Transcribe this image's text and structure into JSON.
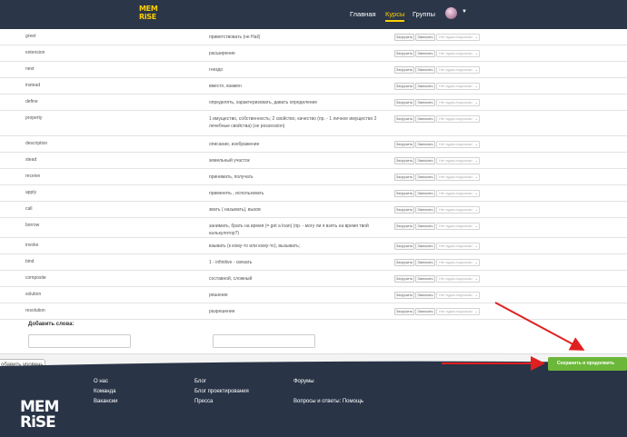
{
  "header": {
    "logo_line1": "MEM",
    "logo_line2": "RiSE",
    "nav": [
      "Главная",
      "Курсы",
      "Группы"
    ],
    "active_nav": "Курсы"
  },
  "rows": [
    {
      "word": "greet",
      "translation": "приветствовать (не Hail)",
      "upload": "Загрузить",
      "record": "Записать",
      "audio": "Нет аудио-подсказки"
    },
    {
      "word": "extension",
      "translation": "расширение",
      "upload": "Загрузить",
      "record": "Записать",
      "audio": "Нет аудио-подсказки"
    },
    {
      "word": "nest",
      "translation": "гнездо",
      "upload": "Загрузить",
      "record": "Записать",
      "audio": "Нет аудио-подсказки"
    },
    {
      "word": "instead",
      "translation": "вместо, взамен",
      "upload": "Загрузить",
      "record": "Записать",
      "audio": "Нет аудио-подсказки"
    },
    {
      "word": "define",
      "translation": "определять, характеризовать, давать определение",
      "upload": "Загрузить",
      "record": "Записать",
      "audio": "Нет аудио-подсказки"
    },
    {
      "word": "property",
      "translation": "1 имущество, собственность; 2 свойство, качество (пр. - 1 личное имущество 2 лечебные свойства) (не possession)",
      "upload": "Загрузить",
      "record": "Записать",
      "audio": "Нет аудио-подсказки"
    },
    {
      "word": "description",
      "translation": "описание, изображение",
      "upload": "Загрузить",
      "record": "Записать",
      "audio": "Нет аудио-подсказки"
    },
    {
      "word": "stead",
      "translation": "земельный участок",
      "upload": "Загрузить",
      "record": "Записать",
      "audio": "Нет аудио-подсказки"
    },
    {
      "word": "receive",
      "translation": "принимать, получать",
      "upload": "Загрузить",
      "record": "Записать",
      "audio": "Нет аудио-подсказки"
    },
    {
      "word": "apply",
      "translation": "применять , использовать",
      "upload": "Загрузить",
      "record": "Записать",
      "audio": "Нет аудио-подсказки"
    },
    {
      "word": "call",
      "translation": "звать ( называть), вызов",
      "upload": "Загрузить",
      "record": "Записать",
      "audio": "Нет аудио-подсказки"
    },
    {
      "word": "borrow",
      "translation": "занимать, брать на время (= get a loan) (пр. - могу ли я взять на время твой калькулятор?)",
      "upload": "Загрузить",
      "record": "Записать",
      "audio": "Нет аудио-подсказки"
    },
    {
      "word": "invoke",
      "translation": "взывать (к кому-то или кому-то), вызывать;",
      "upload": "Загрузить",
      "record": "Записать",
      "audio": "Нет аудио-подсказки"
    },
    {
      "word": "bind",
      "translation": "1 - infinitive - связать",
      "upload": "Загрузить",
      "record": "Записать",
      "audio": "Нет аудио-подсказки"
    },
    {
      "word": "composite",
      "translation": "составной, сложный",
      "upload": "Загрузить",
      "record": "Записать",
      "audio": "Нет аудио-подсказки"
    },
    {
      "word": "solution",
      "translation": "решение",
      "upload": "Загрузить",
      "record": "Записать",
      "audio": "Нет аудио-подсказки"
    },
    {
      "word": "resolution",
      "translation": "разрешение",
      "upload": "Загрузить",
      "record": "Записать",
      "audio": "Нет аудио-подсказки"
    }
  ],
  "add_words": {
    "label": "Добавить слова:"
  },
  "actions": {
    "add_level": "обавить уровень",
    "save": "Сохранить и продолжить"
  },
  "footer": {
    "logo_line1": "MEM",
    "logo_line2": "RiSE",
    "col1": [
      "О нас",
      "Команда",
      "Вакансии"
    ],
    "col2": [
      "Блог",
      "Блог проектирования",
      "Пресса"
    ],
    "col3": [
      "Форумы",
      "",
      "Вопросы и ответы: Помощь"
    ]
  },
  "colors": {
    "header_bg": "#2b3648",
    "brand_yellow": "#ffd000",
    "save_green": "#6cb73a",
    "annotation_red": "#e02020"
  }
}
